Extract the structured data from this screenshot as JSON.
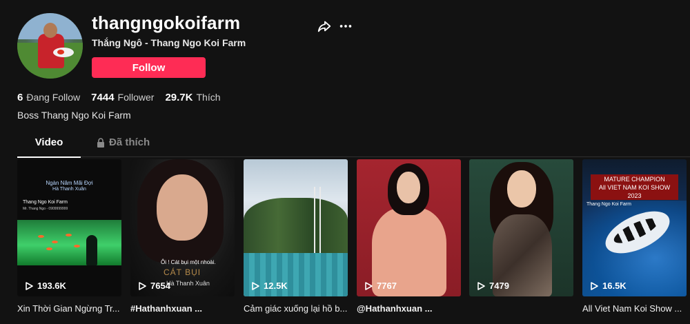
{
  "profile": {
    "username": "thangngokoifarm",
    "nickname": "Thắng Ngô - Thang Ngo Koi Farm",
    "follow_label": "Follow",
    "bio": "Boss Thang Ngo Koi Farm"
  },
  "stats": [
    {
      "value": "6",
      "label": "Đang Follow"
    },
    {
      "value": "7444",
      "label": "Follower"
    },
    {
      "value": "29.7K",
      "label": "Thích"
    }
  ],
  "tabs": {
    "video": "Video",
    "liked": "Đã thích"
  },
  "videos": [
    {
      "views": "193.6K",
      "caption": "Xin Thời Gian Ngừng Tr...",
      "overlay": [
        "Ngàn Năm Mãi Đợi",
        "Hà Thanh Xuân",
        "Thang Ngo Koi Farm",
        "Mr. Thang Ngo - 0909999999"
      ]
    },
    {
      "views": "7654",
      "caption": "#Hathanhxuan ...",
      "overlay": [
        "Ôi ! Cát bụi một nhoài.",
        "CÁT BỤI",
        "Hà Thanh Xuân"
      ]
    },
    {
      "views": "12.5K",
      "caption": "Cảm giác xuống lại hồ b...",
      "overlay": []
    },
    {
      "views": "7767",
      "caption": "@Hathanhxuan ...",
      "overlay": []
    },
    {
      "views": "7479",
      "caption": "",
      "overlay": []
    },
    {
      "views": "16.5K",
      "caption": "All Viet Nam Koi Show ...",
      "overlay": [
        "MATURE CHAMPION",
        "All VIET NAM KOI SHOW",
        "2023",
        "Thang Ngo Koi Farm"
      ]
    }
  ],
  "colors": {
    "background": "#121212",
    "follow_button": "#fe2c55",
    "muted_text": "#8a8a8a"
  }
}
